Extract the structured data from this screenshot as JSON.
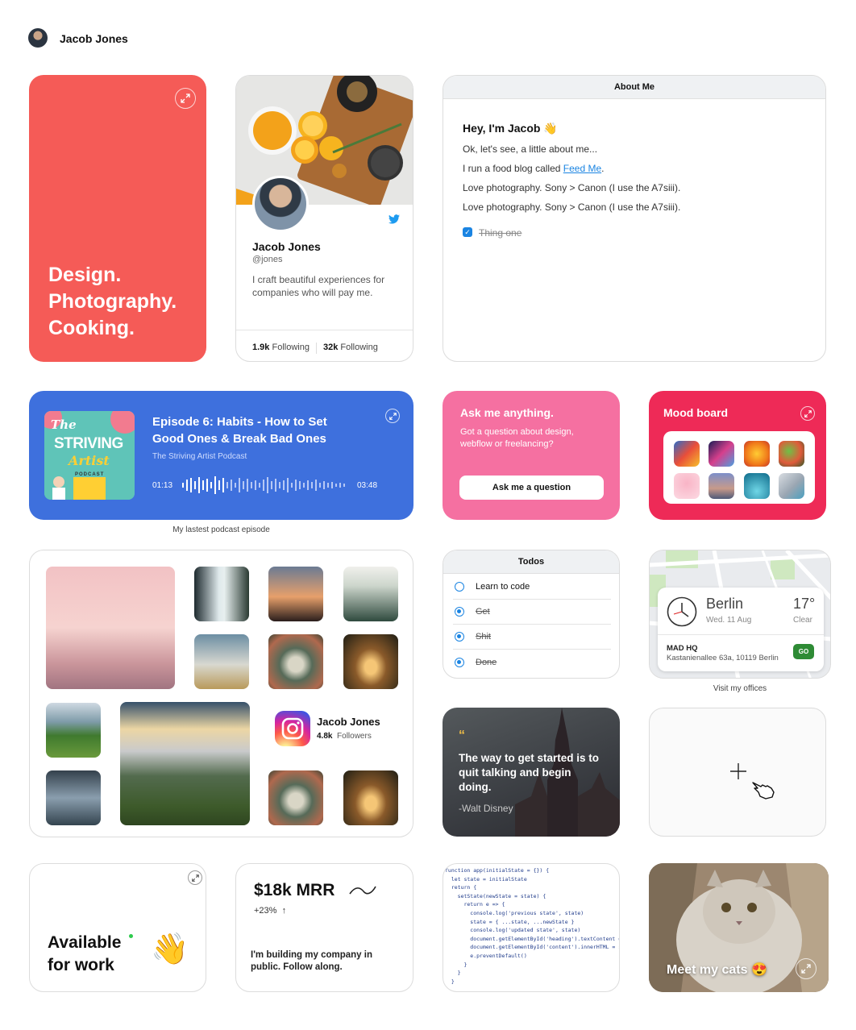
{
  "header": {
    "user_name": "Jacob Jones"
  },
  "hero": {
    "lines": [
      "Design.",
      "Photography.",
      "Cooking."
    ]
  },
  "twitter": {
    "name": "Jacob Jones",
    "handle": "@jones",
    "bio": "I craft beautiful experiences for companies who will pay me.",
    "stat1_value": "1.9k",
    "stat1_label": "Following",
    "stat2_value": "32k",
    "stat2_label": "Following"
  },
  "about": {
    "title": "About Me",
    "greeting": "Hey, I'm Jacob 👋",
    "line1": "Ok, let's see, a little about me...",
    "line2_prefix": "I run a food blog called ",
    "line2_link": "Feed Me",
    "line2_suffix": ".",
    "line3": "Love photography. Sony > Canon (I use the A7siii).",
    "line4": "Love photography. Sony > Canon (I use the A7siii).",
    "checklist_item": "Thing one"
  },
  "podcast": {
    "title": "Episode 6: Habits - How to Set Good Ones & Break Bad Ones",
    "show": "The Striving Artist Podcast",
    "time_current": "01:13",
    "time_total": "03:48",
    "caption": "My lastest podcast episode",
    "art_text_1": "The",
    "art_text_2": "STRIVING",
    "art_text_3": "Artist",
    "art_text_4": "PODCAST"
  },
  "ask": {
    "title": "Ask me anything.",
    "subtitle": "Got a question about design, webflow or freelancing?",
    "button": "Ask me a question"
  },
  "mood": {
    "title": "Mood board"
  },
  "instagram": {
    "name": "Jacob Jones",
    "followers_value": "4.8k",
    "followers_label": "Followers"
  },
  "todos": {
    "title": "Todos",
    "items": [
      {
        "label": "Learn to code",
        "done": false
      },
      {
        "label": "Get",
        "done": true
      },
      {
        "label": "Shit",
        "done": true
      },
      {
        "label": "Done",
        "done": true
      }
    ]
  },
  "map": {
    "city": "Berlin",
    "date": "Wed. 11 Aug",
    "temp": "17°",
    "condition": "Clear",
    "office_name": "MAD HQ",
    "office_address": "Kastanienallee 63a, 10119 Berlin",
    "go_label": "GO",
    "caption": "Visit my offices"
  },
  "quote": {
    "mark": "“",
    "text": "The way to get started is to quit talking and begin doing.",
    "author": "-Walt Disney"
  },
  "available": {
    "line1": "Available",
    "line2": "for work"
  },
  "mrr": {
    "value": "$18k MRR",
    "growth": "+23%",
    "growth_arrow": "↑",
    "description": "I'm building my company in public. Follow along."
  },
  "code": {
    "lines": [
      "function app(initialState = {}) {",
      "  let state = initialState",
      "  return {",
      "    setState(newState = state) {",
      "      return e => {",
      "        console.log('previous state', state)",
      "        state = { ...state, ...newState }",
      "        console.log('updated state', state)",
      "        document.getElementById('heading').textContent = st",
      "        document.getElementById('content').innerHTML = stat",
      "        e.preventDefault()",
      "      }",
      "    }",
      "  }",
      "}"
    ]
  },
  "cats": {
    "title": "Meet my cats 😍"
  },
  "colors": {
    "hero": "#f55b57",
    "podcast": "#3e70dd",
    "ask": "#f570a1",
    "mood": "#ee2a57",
    "link": "#1a84e2"
  }
}
